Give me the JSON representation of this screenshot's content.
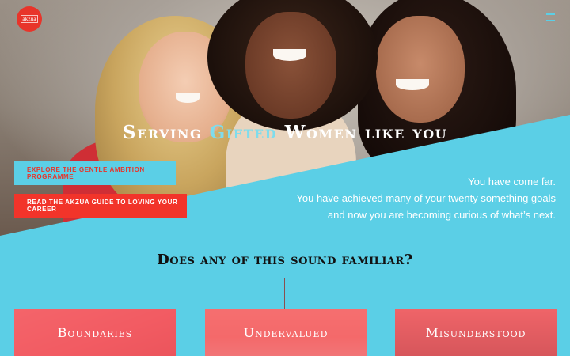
{
  "header": {
    "logo_text": "akzua",
    "menu_icon": "hamburger-menu-icon"
  },
  "hero": {
    "title_pre": "Serving ",
    "title_accent": "Gifted",
    "title_post": " Women like you",
    "buttons": [
      {
        "label": "Explore the Gentle Ambition Programme"
      },
      {
        "label": "Read the Akzua Guide to Loving Your Career"
      }
    ],
    "intro_lines": [
      "You have come far.",
      "You have achieved many of your twenty something goals",
      "and now you are becoming curious of what’s next."
    ]
  },
  "familiar": {
    "title": "Does any of this sound familiar?",
    "cards": [
      {
        "label": "Boundaries"
      },
      {
        "label": "Undervalued"
      },
      {
        "label": "Misunderstood"
      }
    ]
  },
  "colors": {
    "brand_red": "#e8342a",
    "brand_cyan": "#5bcfe6",
    "card_tint": "#f55a60"
  }
}
